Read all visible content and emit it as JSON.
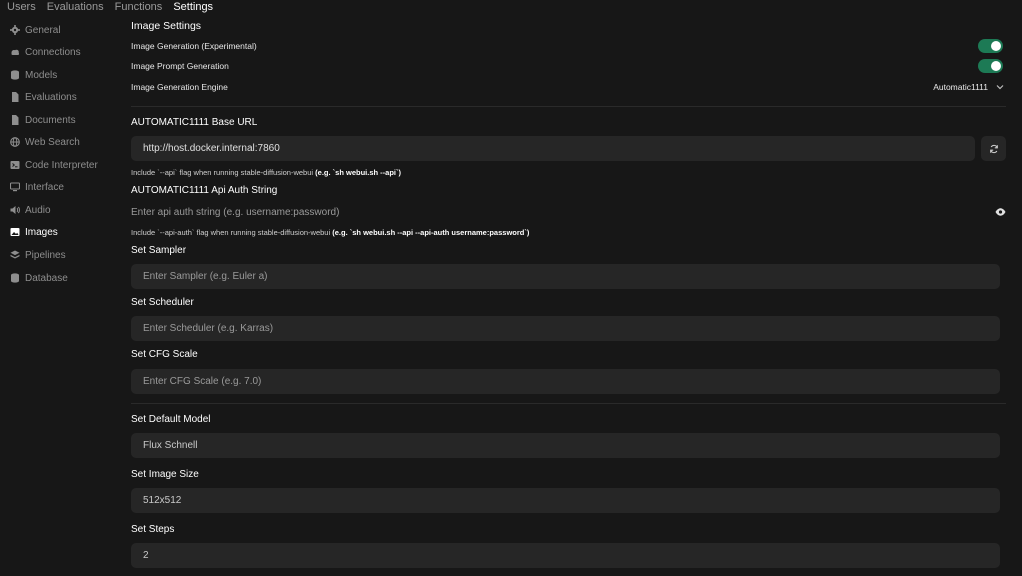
{
  "topnav": {
    "items": [
      "Users",
      "Evaluations",
      "Functions",
      "Settings"
    ]
  },
  "sidebar": {
    "items": [
      {
        "label": "General",
        "icon": "gear-icon"
      },
      {
        "label": "Connections",
        "icon": "cloud-icon"
      },
      {
        "label": "Models",
        "icon": "database-icon"
      },
      {
        "label": "Evaluations",
        "icon": "document-icon"
      },
      {
        "label": "Documents",
        "icon": "document-icon"
      },
      {
        "label": "Web Search",
        "icon": "globe-icon"
      },
      {
        "label": "Code Interpreter",
        "icon": "terminal-icon"
      },
      {
        "label": "Interface",
        "icon": "monitor-icon"
      },
      {
        "label": "Audio",
        "icon": "speaker-icon"
      },
      {
        "label": "Images",
        "icon": "image-icon"
      },
      {
        "label": "Pipelines",
        "icon": "layers-icon"
      },
      {
        "label": "Database",
        "icon": "database-icon"
      }
    ]
  },
  "main": {
    "title": "Image Settings",
    "image_generation_label": "Image Generation (Experimental)",
    "image_generation_enabled": true,
    "image_prompt_generation_label": "Image Prompt Generation",
    "image_prompt_generation_enabled": true,
    "engine_label": "Image Generation Engine",
    "engine_value": "Automatic1111",
    "base_url_label": "AUTOMATIC1111 Base URL",
    "base_url_value": "http://host.docker.internal:7860",
    "base_url_hint_prefix": "Include `--api` flag when running stable-diffusion-webui",
    "base_url_hint_example": "(e.g. `sh webui.sh --api`)",
    "auth_label": "AUTOMATIC1111 Api Auth String",
    "auth_placeholder": "Enter api auth string (e.g. username:password)",
    "auth_hint_prefix": "Include `--api-auth` flag when running stable-diffusion-webui",
    "auth_hint_example": "(e.g. `sh webui.sh --api --api-auth username:password`)",
    "sampler_label": "Set Sampler",
    "sampler_placeholder": "Enter Sampler (e.g. Euler a)",
    "scheduler_label": "Set Scheduler",
    "scheduler_placeholder": "Enter Scheduler (e.g. Karras)",
    "cfg_label": "Set CFG Scale",
    "cfg_placeholder": "Enter CFG Scale (e.g. 7.0)",
    "model_label": "Set Default Model",
    "model_value": "Flux Schnell",
    "size_label": "Set Image Size",
    "size_value": "512x512",
    "steps_label": "Set Steps",
    "steps_value": "2"
  },
  "colors": {
    "accent": "#1d7a55",
    "background": "#171717",
    "field": "#262626"
  }
}
